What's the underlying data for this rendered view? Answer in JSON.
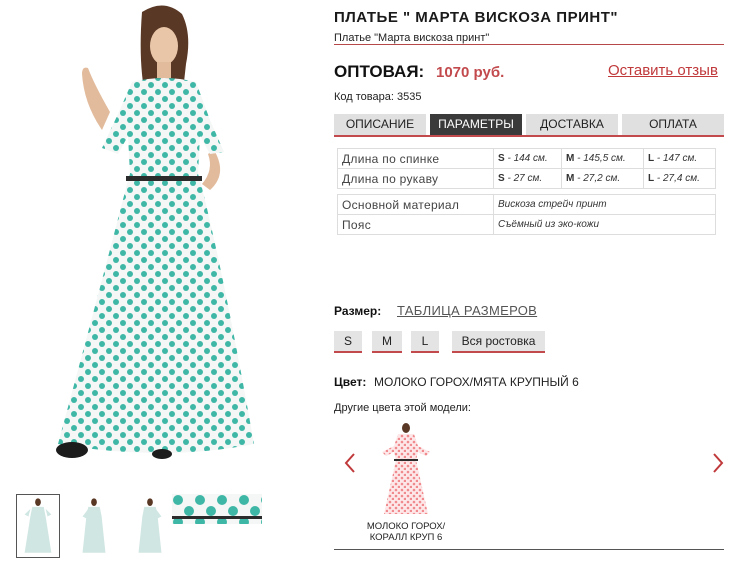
{
  "product": {
    "title": "ПЛАТЬЕ \" МАРТА ВИСКОЗА ПРИНТ\"",
    "subtitle": "Платье \"Марта вискоза принт\"",
    "price_label": "ОПТОВАЯ:",
    "price_value": "1070 руб.",
    "review_link": "Оставить отзыв",
    "sku": "Код товара: 3535"
  },
  "tabs": [
    {
      "label": "ОПИСАНИЕ",
      "active": false
    },
    {
      "label": "ПАРАМЕТРЫ",
      "active": true
    },
    {
      "label": "ДОСТАВКА",
      "active": false
    },
    {
      "label": "ОПЛАТА",
      "active": false
    }
  ],
  "params": {
    "measurements": [
      {
        "name": "Длина по спинке",
        "sizes": [
          {
            "size": "S",
            "value": "144 см."
          },
          {
            "size": "M",
            "value": "145,5 см."
          },
          {
            "size": "L",
            "value": "147 см."
          }
        ]
      },
      {
        "name": "Длина по рукаву",
        "sizes": [
          {
            "size": "S",
            "value": "27 см."
          },
          {
            "size": "M",
            "value": "27,2 см."
          },
          {
            "size": "L",
            "value": "27,4 см."
          }
        ]
      }
    ],
    "attributes": [
      {
        "name": "Основной материал",
        "value": "Вискоза стрейч принт"
      },
      {
        "name": "Пояс",
        "value": "Съёмный из эко-кожи"
      }
    ]
  },
  "sizes": {
    "label": "Размер:",
    "table_link": "ТАБЛИЦА РАЗМЕРОВ",
    "options": [
      "S",
      "M",
      "L"
    ],
    "all_sizes_button": "Вся ростовка"
  },
  "color": {
    "label": "Цвет:",
    "value": "МОЛОКО ГОРОХ/МЯТА КРУПНЫЙ 6",
    "other_colors_label": "Другие цвета этой модели:",
    "variants": [
      {
        "caption": "МОЛОКО ГОРОХ/КОРАЛЛ КРУП 6",
        "dot_color": "#f08a8e"
      }
    ]
  },
  "theme": {
    "accent": "#c24a4d",
    "dress_dots": "#3fb7a6",
    "active_tab": "#3a3a3a"
  },
  "icons": [
    "chevron-left-icon",
    "chevron-right-icon"
  ]
}
